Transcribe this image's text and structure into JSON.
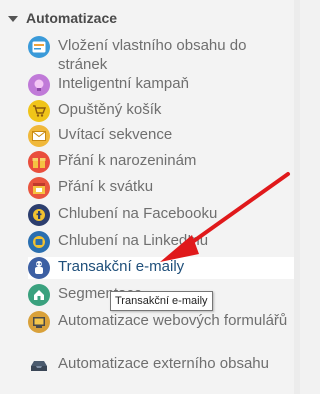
{
  "section": {
    "title": "Automatizace"
  },
  "items": [
    {
      "label": "Vložení vlastního obsahu do stránek",
      "icon": "embed-content-icon"
    },
    {
      "label": "Inteligentní kampaň",
      "icon": "brain-icon"
    },
    {
      "label": "Opuštěný košík",
      "icon": "shopping-cart-icon"
    },
    {
      "label": "Uvítací sekvence",
      "icon": "envelope-icon"
    },
    {
      "label": "Přání k narozeninám",
      "icon": "gift-icon"
    },
    {
      "label": "Přání k svátku",
      "icon": "calendar-icon"
    },
    {
      "label": "Chlubení na Facebooku",
      "icon": "facebook-icon"
    },
    {
      "label": "Chlubení na LinkedInu",
      "icon": "linkedin-icon"
    },
    {
      "label": "Transakční e-maily",
      "icon": "robot-icon",
      "active": true
    },
    {
      "label": "Segmentace",
      "icon": "segment-house-icon"
    },
    {
      "label": "Automatizace webových formulářů",
      "icon": "web-form-icon"
    },
    {
      "label": "Automatizace externího obsahu",
      "icon": "external-inbox-icon"
    }
  ],
  "tooltip": {
    "text": "Transakční e-maily"
  },
  "colors": {
    "accent_active_text": "#1f4f7a",
    "annotation_arrow": "#e0191b"
  }
}
